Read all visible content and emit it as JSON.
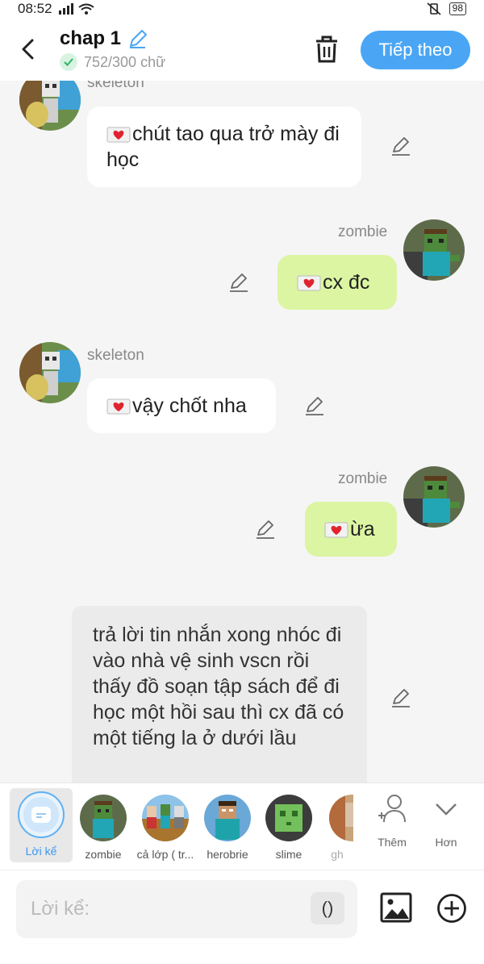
{
  "status": {
    "time": "08:52",
    "battery": "98"
  },
  "header": {
    "title": "chap 1",
    "word_count": "752/300 chữ",
    "next_label": "Tiếp theo"
  },
  "messages": [
    {
      "sender": "skeleton",
      "text": "chút tao qua trở mày đi học",
      "side": "left"
    },
    {
      "sender": "zombie",
      "text": "cx đc",
      "side": "right"
    },
    {
      "sender": "skeleton",
      "text": "vậy chốt nha",
      "side": "left"
    },
    {
      "sender": "zombie",
      "text": "ừa",
      "side": "right"
    },
    {
      "sender": "narration",
      "text": "trả lời tin nhắn xong nhóc đi vào nhà vệ sinh vscn rồi thấy đồ soạn tập sách để đi học một hồi sau thì cx đã có một tiếng la ở dưới lầu",
      "side": "narration"
    }
  ],
  "characters": [
    {
      "label": "Lời kể",
      "icon": "narration-icon"
    },
    {
      "label": "zombie"
    },
    {
      "label": "cả lớp ( tr..."
    },
    {
      "label": "herobrie"
    },
    {
      "label": "slime"
    },
    {
      "label": "gh"
    }
  ],
  "tools": {
    "add_label": "Thêm",
    "more_label": "Hơn"
  },
  "input": {
    "placeholder": "Lời kể:",
    "paren_label": "()"
  },
  "colors": {
    "accent": "#4aa6f5",
    "green_bubble": "#dcf5a3",
    "white_bubble": "#ffffff",
    "narration_bubble": "#ebebeb"
  }
}
